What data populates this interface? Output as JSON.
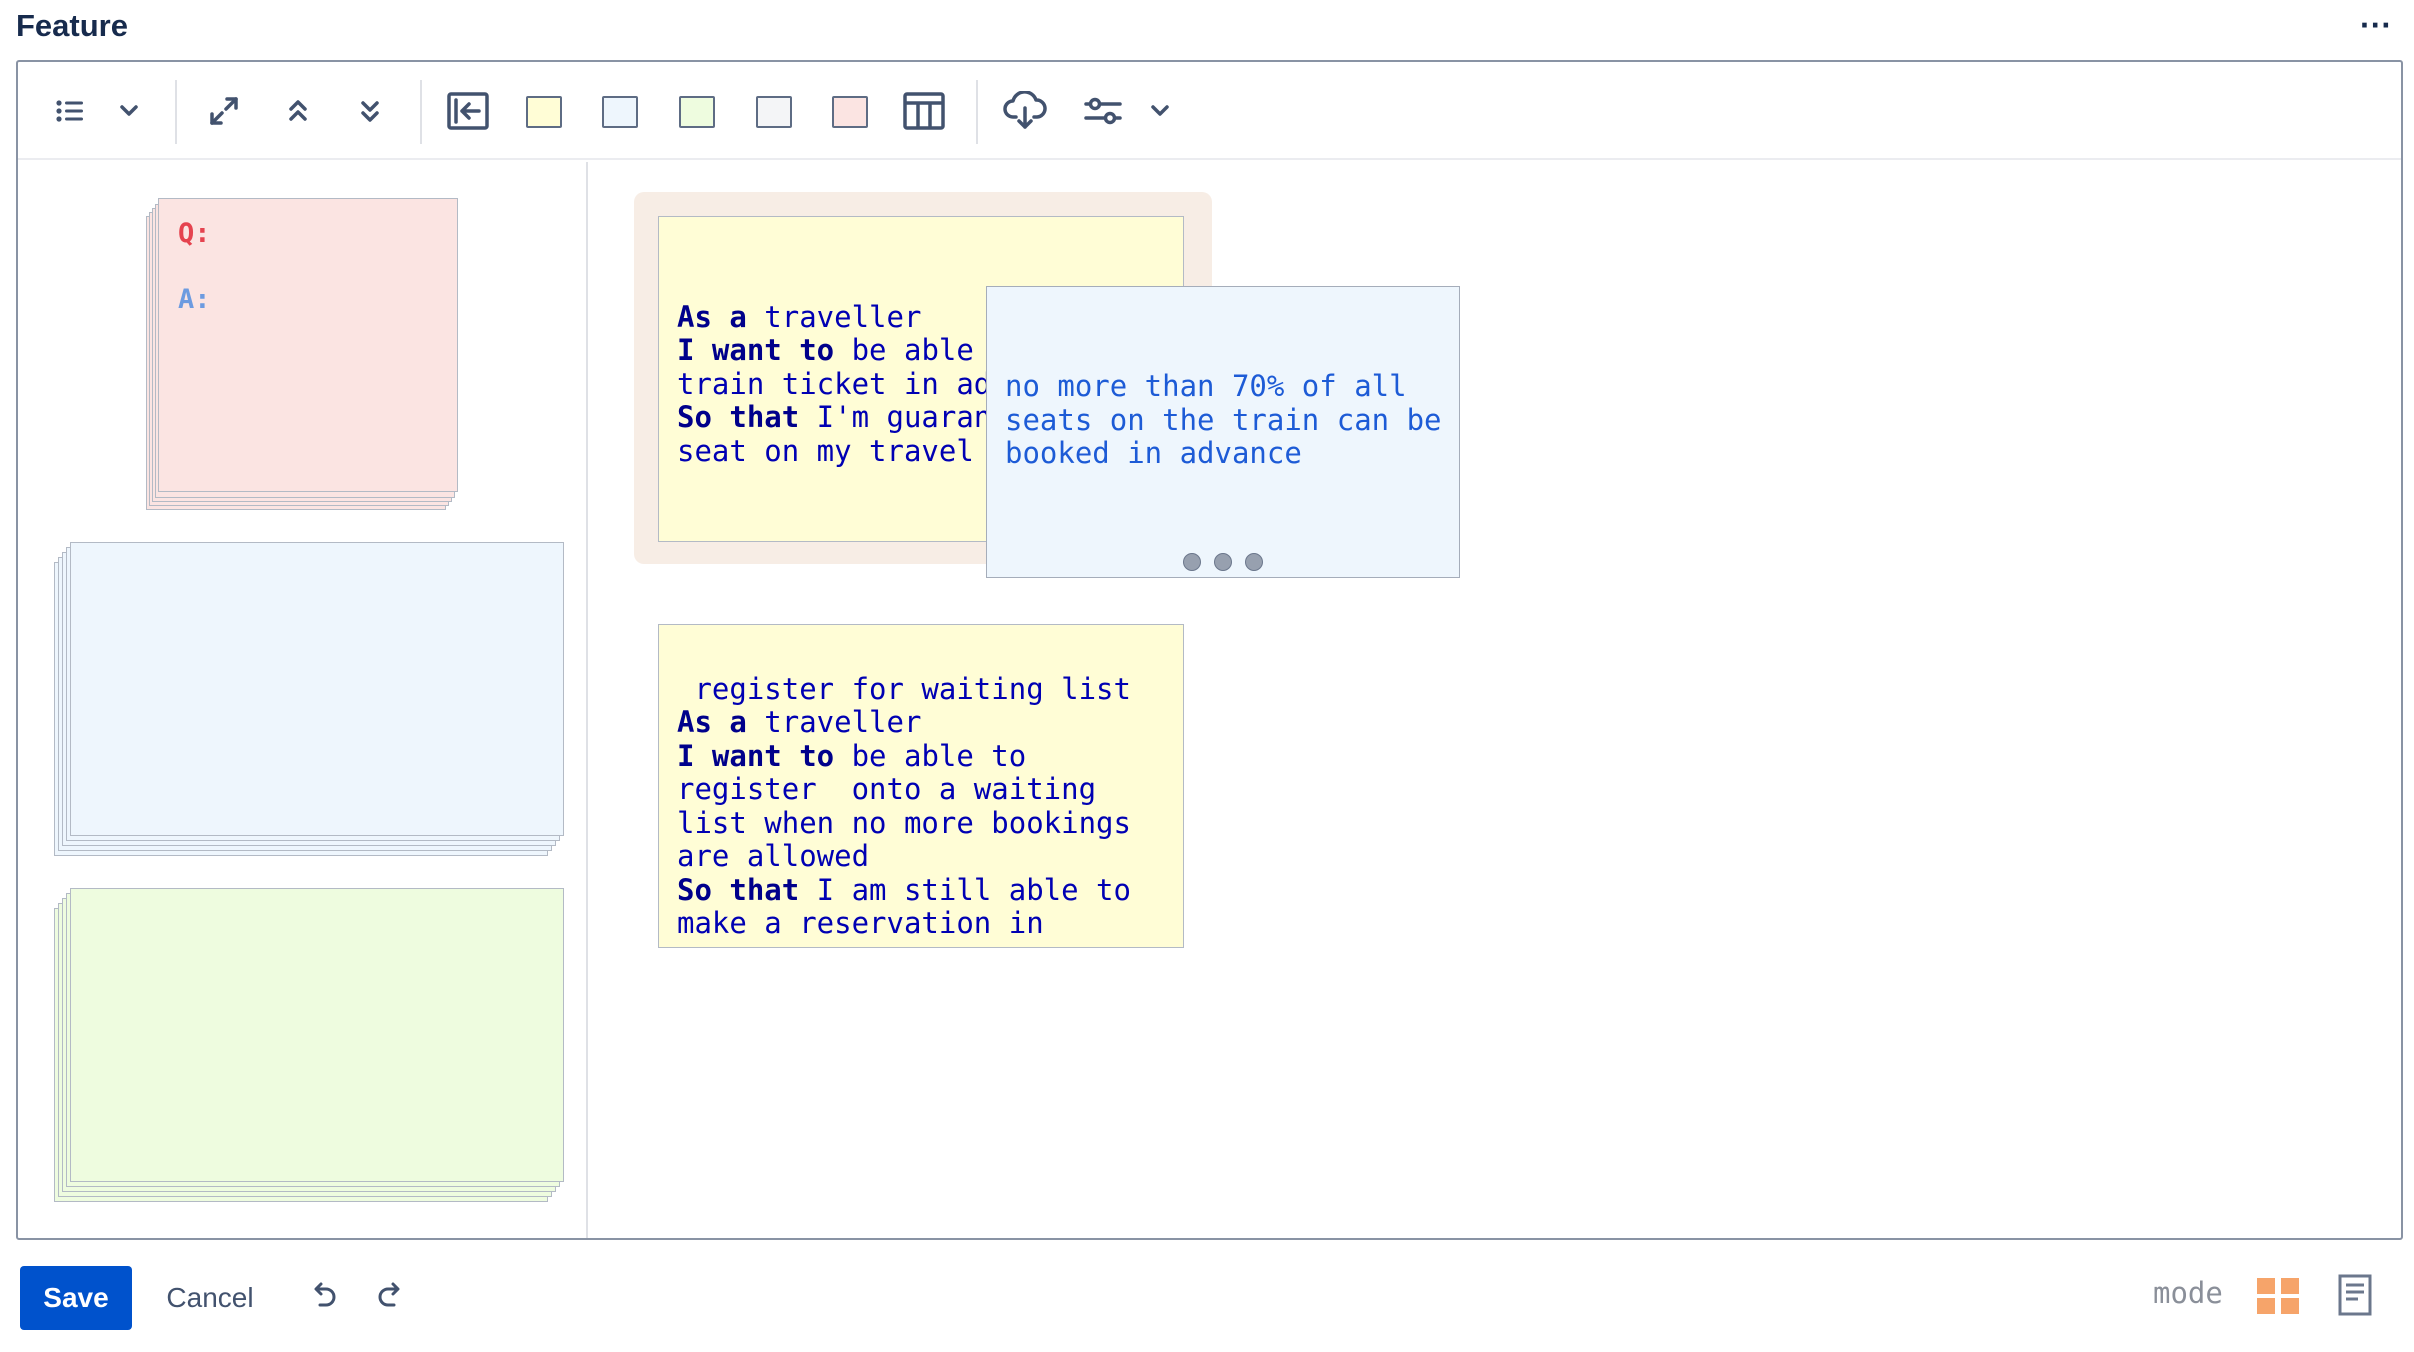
{
  "header": {
    "title": "Feature",
    "more": "···"
  },
  "toolbar": {
    "swatch_colors": [
      "#fffdd6",
      "#eef6fd",
      "#eefcdf",
      "#f4f5f7",
      "#fbe4e2"
    ]
  },
  "sidebar": {
    "qa": {
      "q": "Q:",
      "a": "A:"
    }
  },
  "canvas": {
    "group_card": {
      "line1_bold": "As a",
      "line1_rest": " traveller",
      "line2_bold": "I want to",
      "line2_rest": " be able",
      "line3": "train ticket in ad",
      "line4_bold": "So that",
      "line4_rest": " I'm guaran",
      "line5": "seat on my travel"
    },
    "note_card": {
      "text": "no more than 70% of all\nseats on the train can be\nbooked in advance"
    },
    "story_card": {
      "title": " register for waiting list",
      "l1_bold": "As a",
      "l1_rest": " traveller",
      "l2_bold": "I want to",
      "l2_rest": " be able to",
      "l3": "register  onto a waiting",
      "l4": "list when no more bookings",
      "l5": "are allowed",
      "l6_bold": "So that",
      "l6_rest": " I am still able to",
      "l7": "make a reservation in"
    }
  },
  "footer": {
    "save": "Save",
    "cancel": "Cancel",
    "mode": "mode"
  },
  "colors": {
    "primary": "#0052cc",
    "mode_grid": "#f6a46a"
  }
}
